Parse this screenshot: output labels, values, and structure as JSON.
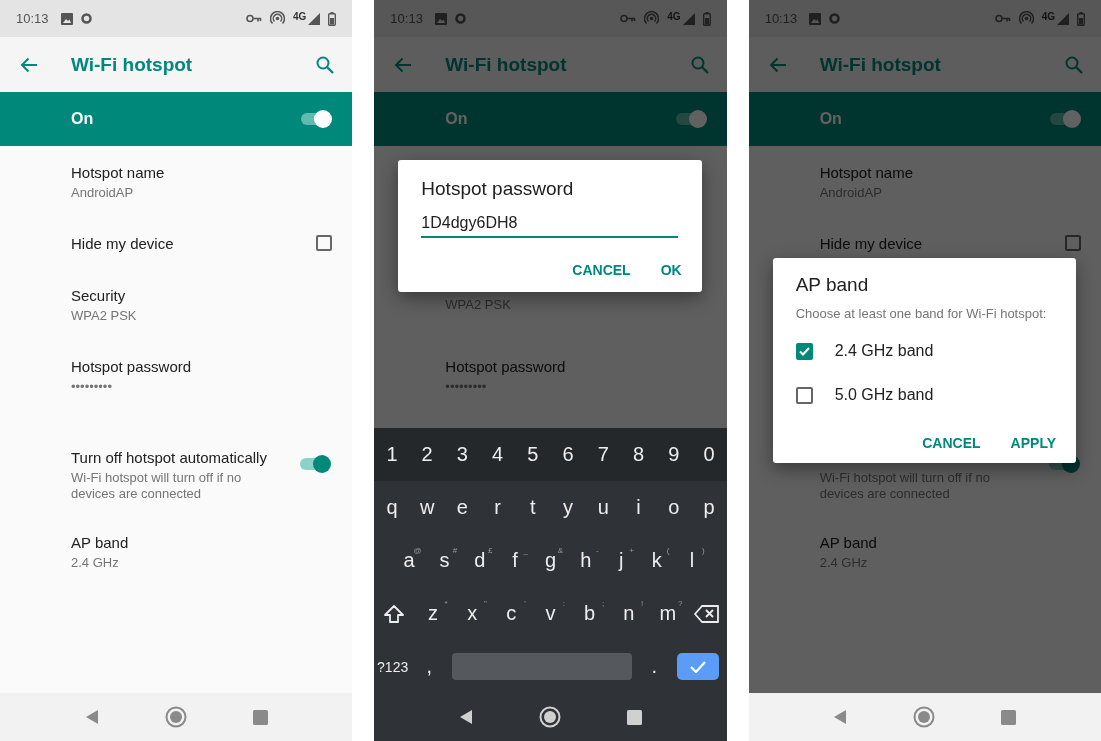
{
  "phones": [
    {
      "status_bar": {
        "time": "10:13",
        "network": "4G"
      },
      "app_bar": {
        "title": "Wi-Fi hotspot"
      },
      "master": {
        "label": "On",
        "on": true
      },
      "settings": [
        {
          "kind": "text",
          "title": "Hotspot name",
          "summary": "AndroidAP"
        },
        {
          "kind": "checkbox",
          "title": "Hide my device",
          "checked": false
        },
        {
          "kind": "text",
          "title": "Security",
          "summary": "WPA2 PSK"
        },
        {
          "kind": "text",
          "title": "Hotspot password",
          "summary": "•••••••••"
        },
        {
          "kind": "switch",
          "title": "Turn off hotspot automatically",
          "summary": "Wi-Fi hotspot will turn off if no devices are connected",
          "on": true
        },
        {
          "kind": "text",
          "title": "AP band",
          "summary": "2.4 GHz"
        }
      ],
      "nav_bar": {
        "dark": false
      }
    },
    {
      "status_bar": {
        "time": "10:13",
        "network": "4G"
      },
      "app_bar": {
        "title": "Wi-Fi hotspot"
      },
      "master": {
        "label": "On",
        "on": true
      },
      "settings": [
        {
          "kind": "text"
        },
        {
          "kind": "checkbox"
        },
        {
          "kind": "text",
          "summary": "WPA2 PSK"
        },
        {
          "kind": "text",
          "title": "Hotspot password",
          "summary": "•••••••••"
        }
      ],
      "dialog": {
        "kind": "input",
        "title": "Hotspot password",
        "value": "1D4dgy6DH8",
        "buttons": [
          "CANCEL",
          "OK"
        ]
      },
      "keyboard": {
        "rows": [
          {
            "kind": "numbers",
            "keys": [
              {
                "kind": "char",
                "label": "1"
              },
              {
                "kind": "char",
                "label": "2"
              },
              {
                "kind": "char",
                "label": "3"
              },
              {
                "kind": "char",
                "label": "4"
              },
              {
                "kind": "char",
                "label": "5"
              },
              {
                "kind": "char",
                "label": "6"
              },
              {
                "kind": "char",
                "label": "7"
              },
              {
                "kind": "char",
                "label": "8"
              },
              {
                "kind": "char",
                "label": "9"
              },
              {
                "kind": "char",
                "label": "0"
              }
            ]
          },
          {
            "kind": "letters",
            "keys": [
              {
                "kind": "char",
                "label": "q"
              },
              {
                "kind": "char",
                "label": "w"
              },
              {
                "kind": "char",
                "label": "e"
              },
              {
                "kind": "char",
                "label": "r"
              },
              {
                "kind": "char",
                "label": "t"
              },
              {
                "kind": "char",
                "label": "y"
              },
              {
                "kind": "char",
                "label": "u"
              },
              {
                "kind": "char",
                "label": "i"
              },
              {
                "kind": "char",
                "label": "o"
              },
              {
                "kind": "char",
                "label": "p"
              }
            ]
          },
          {
            "kind": "indented",
            "keys": [
              {
                "kind": "char",
                "label": "a",
                "hint": "@"
              },
              {
                "kind": "char",
                "label": "s",
                "hint": "#"
              },
              {
                "kind": "char",
                "label": "d",
                "hint": "£"
              },
              {
                "kind": "char",
                "label": "f",
                "hint": "_"
              },
              {
                "kind": "char",
                "label": "g",
                "hint": "&"
              },
              {
                "kind": "char",
                "label": "h",
                "hint": "-"
              },
              {
                "kind": "char",
                "label": "j",
                "hint": "+"
              },
              {
                "kind": "char",
                "label": "k",
                "hint": "("
              },
              {
                "kind": "char",
                "label": "l",
                "hint": ")"
              }
            ]
          },
          {
            "kind": "letters",
            "keys": [
              {
                "kind": "shift"
              },
              {
                "kind": "char",
                "label": "z",
                "hint": "*"
              },
              {
                "kind": "char",
                "label": "x",
                "hint": "\""
              },
              {
                "kind": "char",
                "label": "c",
                "hint": "'"
              },
              {
                "kind": "char",
                "label": "v",
                "hint": ":"
              },
              {
                "kind": "char",
                "label": "b",
                "hint": ";"
              },
              {
                "kind": "char",
                "label": "n",
                "hint": "!"
              },
              {
                "kind": "char",
                "label": "m",
                "hint": "?"
              },
              {
                "kind": "backspace"
              }
            ]
          },
          {
            "kind": "letters",
            "keys": [
              {
                "kind": "symbols",
                "label": "?123"
              },
              {
                "kind": "char",
                "label": ","
              },
              {
                "kind": "space"
              },
              {
                "kind": "char",
                "label": "."
              },
              {
                "kind": "done"
              }
            ]
          }
        ]
      },
      "nav_bar": {
        "dark": true
      }
    },
    {
      "status_bar": {
        "time": "10:13",
        "network": "4G"
      },
      "app_bar": {
        "title": "Wi-Fi hotspot"
      },
      "master": {
        "label": "On",
        "on": true
      },
      "settings": [
        {
          "kind": "text",
          "title": "Hotspot name",
          "summary": "AndroidAP"
        },
        {
          "kind": "checkbox",
          "title": "Hide my device",
          "checked": false
        },
        {
          "kind": "text"
        },
        {
          "kind": "text"
        },
        {
          "kind": "switch",
          "summary": "Wi-Fi hotspot will turn off if no devices are connected",
          "on": true
        },
        {
          "kind": "text",
          "title": "AP band",
          "summary": "2.4 GHz"
        }
      ],
      "dialog": {
        "kind": "choice",
        "title": "AP band",
        "message": "Choose at least one band for Wi-Fi hotspot:",
        "options": [
          {
            "label": "2.4 GHz band",
            "checked": true
          },
          {
            "label": "5.0 GHz band",
            "checked": false
          }
        ],
        "buttons": [
          "CANCEL",
          "APPLY"
        ]
      },
      "nav_bar": {
        "dark": false
      }
    }
  ]
}
